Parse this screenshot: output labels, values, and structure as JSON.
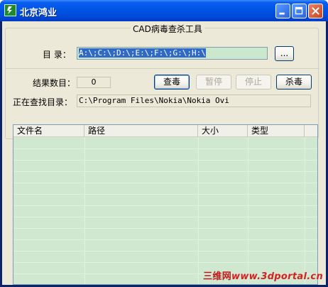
{
  "window": {
    "title": "北京鸿业",
    "icon": "app-logo-icon",
    "accent": "#0055e5"
  },
  "tool": {
    "group_title": "CAD病毒查杀工具",
    "directory_label": "目 录：",
    "directory_value": "A:\\;C:\\;D:\\;E:\\;F:\\;G:\\;H:\\",
    "browse_label": "...",
    "result_count_label": "结果数目：",
    "result_count_value": "0",
    "scan_button": "查毒",
    "pause_button": "暂停",
    "stop_button": "停止",
    "kill_button": "杀毒",
    "searching_label": "正在查找目录：",
    "searching_value": "C:\\Program Files\\Nokia\\Nokia Ovi"
  },
  "table": {
    "columns": [
      "文件名",
      "路径",
      "大小",
      "类型"
    ],
    "rows": []
  },
  "watermark": {
    "cn": "三维网",
    "url": "www.3dportal.cn"
  }
}
